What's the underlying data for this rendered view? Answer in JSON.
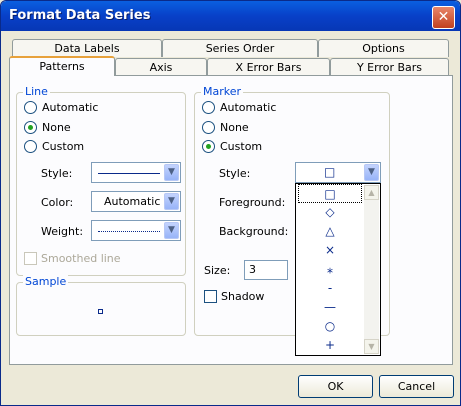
{
  "window": {
    "title": "Format Data Series",
    "close_glyph": "✕"
  },
  "tabs_back": [
    "Data Labels",
    "Series Order",
    "Options"
  ],
  "tabs_front": [
    "Patterns",
    "Axis",
    "X Error Bars",
    "Y Error Bars"
  ],
  "line": {
    "label": "Line",
    "automatic": "Automatic",
    "none": "None",
    "custom": "Custom",
    "selected": "None",
    "style_label": "Style:",
    "color_label": "Color:",
    "color_value": "Automatic",
    "weight_label": "Weight:",
    "smoothed": "Smoothed line"
  },
  "sample": {
    "label": "Sample"
  },
  "marker": {
    "label": "Marker",
    "automatic": "Automatic",
    "none": "None",
    "custom": "Custom",
    "selected": "Custom",
    "style_label": "Style:",
    "style_value": "□",
    "foreground_label": "Foreground:",
    "background_label": "Background:",
    "size_label": "Size:",
    "size_value": "3",
    "shadow": "Shadow",
    "style_options": [
      "□",
      "◇",
      "△",
      "×",
      "⁎",
      "-",
      "—",
      "○",
      "+"
    ]
  },
  "buttons": {
    "ok": "OK",
    "cancel": "Cancel"
  }
}
